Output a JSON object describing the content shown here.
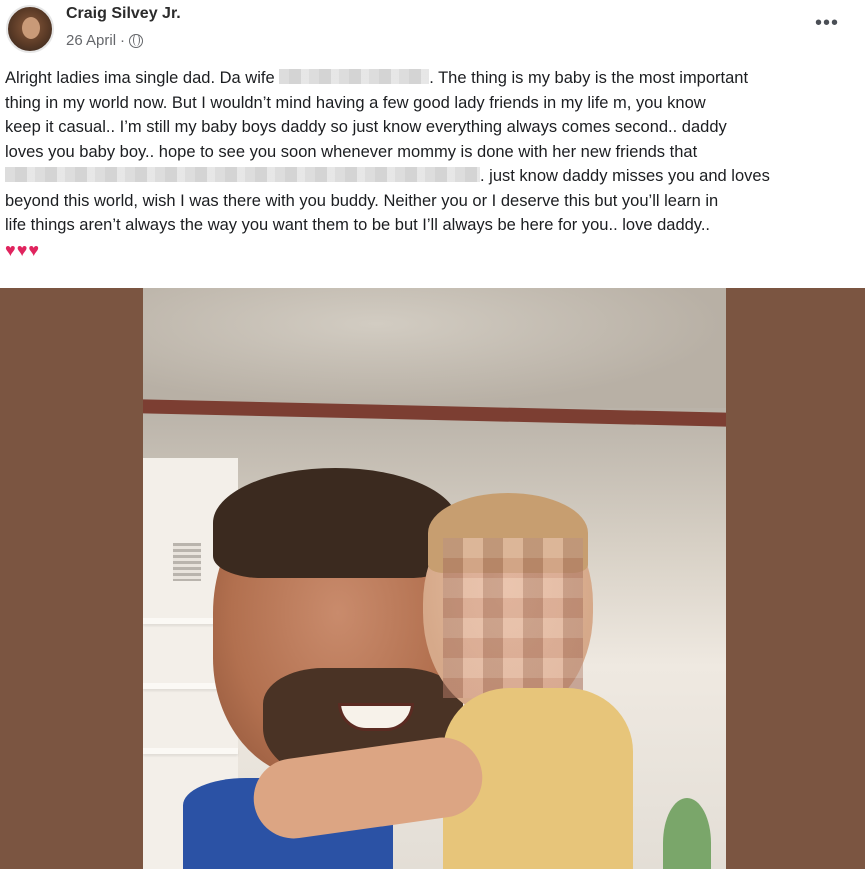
{
  "post": {
    "author": "Craig Silvey Jr.",
    "date": "26 April",
    "separator": "·",
    "lines": [
      {
        "before": "Alright ladies ima single dad. Da wife ",
        "after": ". The thing is my baby is the most important"
      },
      {
        "text": "thing in my world now. But I wouldn’t mind having a few good lady friends in my life m, you know"
      },
      {
        "text": "keep it casual.. I’m still my baby boys daddy so just know everything always comes second.. daddy"
      },
      {
        "text": "loves you baby boy.. hope to see you soon whenever mommy is done with her new friends that"
      },
      {
        "before": "",
        "after": ". just know daddy misses you and loves"
      },
      {
        "text": "beyond this world, wish I was there with you buddy. Neither you or I deserve this but you’ll learn in"
      },
      {
        "text": "life things aren’t always the way you want them to be but I’ll always be here for you.. love daddy.."
      }
    ],
    "hearts": "♥♥♥"
  },
  "colors": {
    "text": "#1c1e21",
    "meta": "#65676b",
    "photo_frame": "#7b5541",
    "hearts": "#e0245e"
  },
  "icons": {
    "privacy": "globe-icon",
    "menu": "more-options-icon"
  }
}
